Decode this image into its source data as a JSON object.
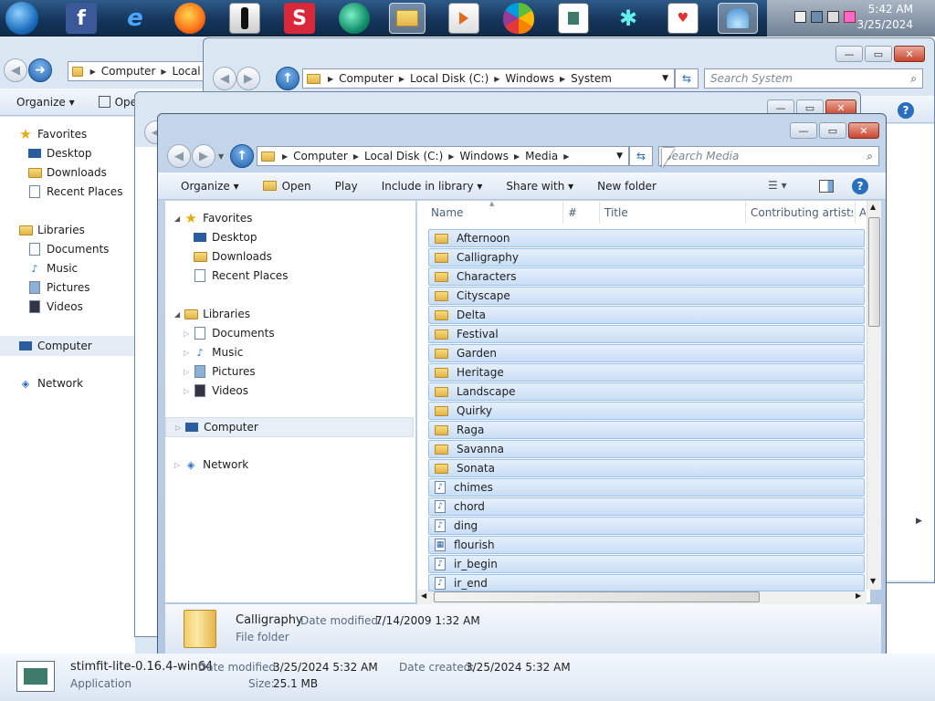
{
  "taskbar": {
    "icons": [
      {
        "name": "start-orb-icon",
        "label": ""
      },
      {
        "name": "facebook-icon",
        "label": "f"
      },
      {
        "name": "internet-explorer-icon",
        "label": "e"
      },
      {
        "name": "firefox-icon",
        "label": ""
      },
      {
        "name": "silhouette-shortcut-icon",
        "label": ""
      },
      {
        "name": "stimfit-s-icon",
        "label": "S"
      },
      {
        "name": "green-swirl-icon",
        "label": ""
      },
      {
        "name": "explorer-icon",
        "label": ""
      },
      {
        "name": "media-player-icon",
        "label": ""
      },
      {
        "name": "apple-icon",
        "label": ""
      },
      {
        "name": "document-viewer-icon",
        "label": ""
      },
      {
        "name": "network-tool-icon",
        "label": ""
      },
      {
        "name": "calendar-heart-icon",
        "label": ""
      },
      {
        "name": "shell-icon",
        "label": ""
      }
    ],
    "clock_time": "5:42 AM",
    "clock_date": "3/25/2024"
  },
  "back_window": {
    "address": [
      "Computer",
      "Local I"
    ],
    "organize": "Organize",
    "open": "Ope",
    "nav": [
      "Favorites",
      "Desktop",
      "Downloads",
      "Recent Places",
      "Libraries",
      "Documents",
      "Music",
      "Pictures",
      "Videos",
      "Computer",
      "Network"
    ]
  },
  "system_window": {
    "address": [
      "Computer",
      "Local Disk (C:)",
      "Windows",
      "System"
    ],
    "search_placeholder": "Search System"
  },
  "media_window": {
    "address": [
      "Computer",
      "Local Disk (C:)",
      "Windows",
      "Media"
    ],
    "search_placeholder": "Search Media",
    "commands": {
      "organize": "Organize",
      "open": "Open",
      "play": "Play",
      "include": "Include in library",
      "share": "Share with",
      "new_folder": "New folder"
    },
    "nav": {
      "favorites": "Favorites",
      "desktop": "Desktop",
      "downloads": "Downloads",
      "recent": "Recent Places",
      "libraries": "Libraries",
      "documents": "Documents",
      "music": "Music",
      "pictures": "Pictures",
      "videos": "Videos",
      "computer": "Computer",
      "network": "Network"
    },
    "columns": [
      "Name",
      "#",
      "Title",
      "Contributing artists",
      "A"
    ],
    "files": [
      {
        "name": "Afternoon",
        "type": "folder"
      },
      {
        "name": "Calligraphy",
        "type": "folder"
      },
      {
        "name": "Characters",
        "type": "folder"
      },
      {
        "name": "Cityscape",
        "type": "folder"
      },
      {
        "name": "Delta",
        "type": "folder"
      },
      {
        "name": "Festival",
        "type": "folder"
      },
      {
        "name": "Garden",
        "type": "folder"
      },
      {
        "name": "Heritage",
        "type": "folder"
      },
      {
        "name": "Landscape",
        "type": "folder"
      },
      {
        "name": "Quirky",
        "type": "folder"
      },
      {
        "name": "Raga",
        "type": "folder"
      },
      {
        "name": "Savanna",
        "type": "folder"
      },
      {
        "name": "Sonata",
        "type": "folder"
      },
      {
        "name": "chimes",
        "type": "audio"
      },
      {
        "name": "chord",
        "type": "audio"
      },
      {
        "name": "ding",
        "type": "audio"
      },
      {
        "name": "flourish",
        "type": "midi"
      },
      {
        "name": "ir_begin",
        "type": "audio"
      },
      {
        "name": "ir_end",
        "type": "audio"
      }
    ],
    "details": {
      "name": "Calligraphy",
      "modified_label": "Date modified:",
      "modified": "7/14/2009 1:32 AM",
      "type": "File folder"
    }
  },
  "bottom_details": {
    "name": "stimfit-lite-0.16.4-win64",
    "type": "Application",
    "modified_label": "Date modified:",
    "modified": "3/25/2024 5:32 AM",
    "created_label": "Date created:",
    "created": "3/25/2024 5:32 AM",
    "size_label": "Size:",
    "size": "25.1 MB"
  }
}
